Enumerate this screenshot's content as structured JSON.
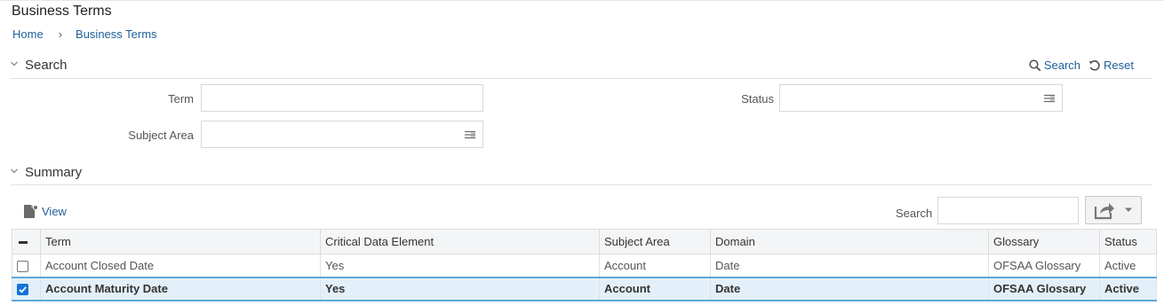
{
  "header": {
    "title": "Business Terms",
    "breadcrumb": [
      "Home",
      "Business Terms"
    ]
  },
  "search": {
    "section_label": "Search",
    "search_action": "Search",
    "reset_action": "Reset",
    "fields": {
      "term_label": "Term",
      "term_value": "",
      "status_label": "Status",
      "status_value": "",
      "subject_area_label": "Subject Area",
      "subject_area_value": ""
    }
  },
  "summary": {
    "section_label": "Summary",
    "view_label": "View",
    "table_search_label": "Search",
    "table_search_value": "",
    "columns": [
      "Term",
      "Critical Data Element",
      "Subject Area",
      "Domain",
      "Glossary",
      "Status"
    ],
    "rows": [
      {
        "term": "Account Closed Date",
        "cde": "Yes",
        "subject_area": "Account",
        "domain": "Date",
        "glossary": "OFSAA Glossary",
        "status": "Active",
        "selected": false
      },
      {
        "term": "Account Maturity Date",
        "cde": "Yes",
        "subject_area": "Account",
        "domain": "Date",
        "glossary": "OFSAA Glossary",
        "status": "Active",
        "selected": true
      }
    ]
  },
  "colors": {
    "link": "#1f5f99",
    "selected_row_bg": "#e4f0f9",
    "selected_row_border": "#5da8dc",
    "checkbox_checked": "#1473d9"
  }
}
